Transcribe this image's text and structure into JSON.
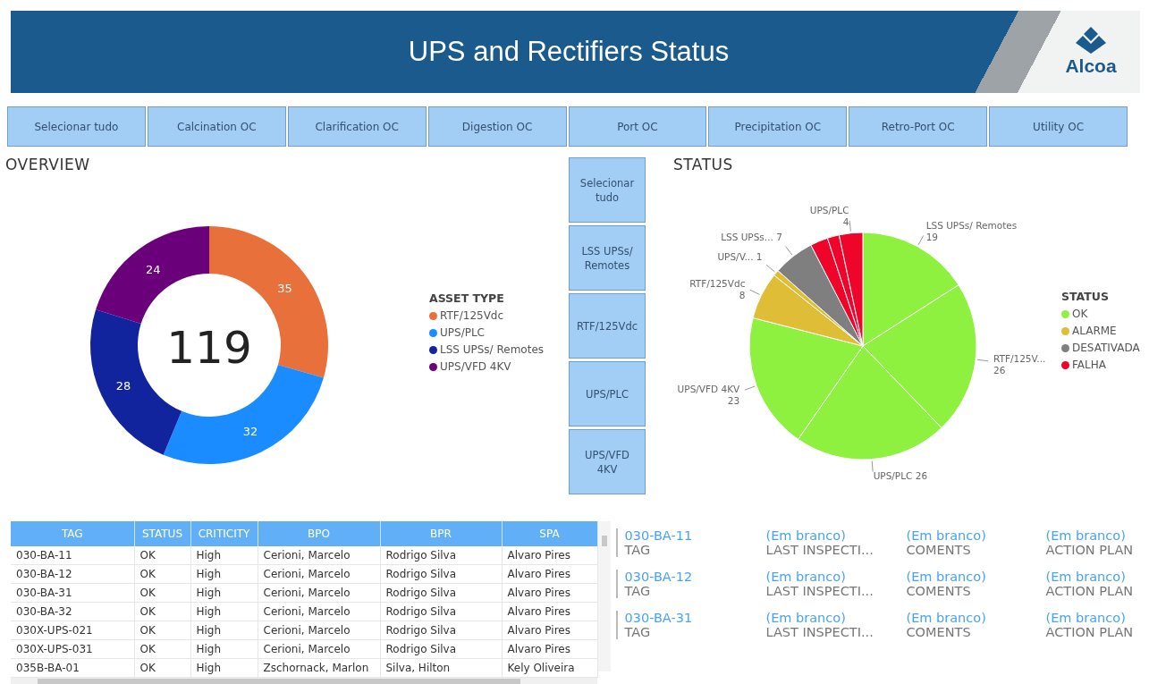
{
  "header": {
    "title": "UPS and Rectifiers Status",
    "logo_text": "Alcoa"
  },
  "area_filters": [
    {
      "label": "Selecionar tudo"
    },
    {
      "label": "Calcination OC"
    },
    {
      "label": "Clarification OC"
    },
    {
      "label": "Digestion OC"
    },
    {
      "label": "Port OC"
    },
    {
      "label": "Precipitation OC"
    },
    {
      "label": "Retro-Port OC"
    },
    {
      "label": "Utility OC"
    }
  ],
  "overview": {
    "title": "OVERVIEW",
    "total": "119",
    "legend": {
      "title": "ASSET TYPE",
      "items": [
        {
          "label": "RTF/125Vdc",
          "color": "#e8703a"
        },
        {
          "label": "UPS/PLC",
          "color": "#1a8cff"
        },
        {
          "label": "LSS UPSs/ Remotes",
          "color": "#12239e"
        },
        {
          "label": "UPS/VFD 4KV",
          "color": "#6b007b"
        }
      ]
    },
    "chart_data": {
      "type": "donut",
      "values": [
        35,
        32,
        28,
        24
      ],
      "data_labels": true
    }
  },
  "asset_filters": [
    {
      "label": "Selecionar tudo"
    },
    {
      "label": "LSS UPSs/ Remotes"
    },
    {
      "label": "RTF/125Vdc"
    },
    {
      "label": "UPS/PLC"
    },
    {
      "label": "UPS/VFD 4KV"
    }
  ],
  "status": {
    "title": "STATUS",
    "legend": {
      "title": "STATUS",
      "items": [
        {
          "label": "OK",
          "color": "#8ff13f"
        },
        {
          "label": "ALARME",
          "color": "#dfbd36"
        },
        {
          "label": "DESATIVADA",
          "color": "#7f7f7f"
        },
        {
          "label": "FALHA",
          "color": "#f0052a"
        }
      ]
    },
    "chart_data": {
      "type": "pie",
      "categories": [
        "LSS UPSs/ Remotes",
        "RTF/125V...",
        "UPS/PLC",
        "UPS/VFD 4KV",
        "RTF/125Vdc",
        "UPS/V...",
        "LSS UPSs...",
        null,
        null,
        "UPS/PLC"
      ],
      "values": [
        19,
        26,
        26,
        23,
        8,
        1,
        7,
        3,
        2,
        4
      ],
      "colors": [
        "#8ff13f",
        "#8ff13f",
        "#8ff13f",
        "#8ff13f",
        "#dfbd36",
        "#dfbd36",
        "#7f7f7f",
        "#f0052a",
        "#f0052a",
        "#f0052a"
      ],
      "value_labels": [
        "19",
        "26",
        "26",
        "23",
        "8",
        "1",
        "7",
        null,
        null,
        "4"
      ]
    }
  },
  "table": {
    "columns": [
      "TAG",
      "STATUS",
      "CRITICITY",
      "BPO",
      "BPR",
      "SPA"
    ],
    "rows": [
      [
        "030-BA-11",
        "OK",
        "High",
        "Cerioni, Marcelo",
        "Rodrigo Silva",
        "Alvaro Pires"
      ],
      [
        "030-BA-12",
        "OK",
        "High",
        "Cerioni, Marcelo",
        "Rodrigo Silva",
        "Alvaro Pires"
      ],
      [
        "030-BA-31",
        "OK",
        "High",
        "Cerioni, Marcelo",
        "Rodrigo Silva",
        "Alvaro Pires"
      ],
      [
        "030-BA-32",
        "OK",
        "High",
        "Cerioni, Marcelo",
        "Rodrigo Silva",
        "Alvaro Pires"
      ],
      [
        "030X-UPS-021",
        "OK",
        "High",
        "Cerioni, Marcelo",
        "Rodrigo Silva",
        "Alvaro Pires"
      ],
      [
        "030X-UPS-031",
        "OK",
        "High",
        "Cerioni, Marcelo",
        "Rodrigo Silva",
        "Alvaro Pires"
      ],
      [
        "035B-BA-01",
        "OK",
        "High",
        "Zschornack, Marlon",
        "Silva, Hilton",
        "Kely Oliveira"
      ]
    ]
  },
  "records": [
    {
      "fields": [
        {
          "value": "030-BA-11",
          "label": "TAG"
        },
        {
          "value": "(Em branco)",
          "label": "LAST INSPECTI..."
        },
        {
          "value": "(Em branco)",
          "label": "COMENTS"
        },
        {
          "value": "(Em branco)",
          "label": "ACTION PLAN"
        }
      ]
    },
    {
      "fields": [
        {
          "value": "030-BA-12",
          "label": "TAG"
        },
        {
          "value": "(Em branco)",
          "label": "LAST INSPECTI..."
        },
        {
          "value": "(Em branco)",
          "label": "COMENTS"
        },
        {
          "value": "(Em branco)",
          "label": "ACTION PLAN"
        }
      ]
    },
    {
      "fields": [
        {
          "value": "030-BA-31",
          "label": "TAG"
        },
        {
          "value": "(Em branco)",
          "label": "LAST INSPECTI..."
        },
        {
          "value": "(Em branco)",
          "label": "COMENTS"
        },
        {
          "value": "(Em branco)",
          "label": "ACTION PLAN"
        }
      ]
    }
  ]
}
